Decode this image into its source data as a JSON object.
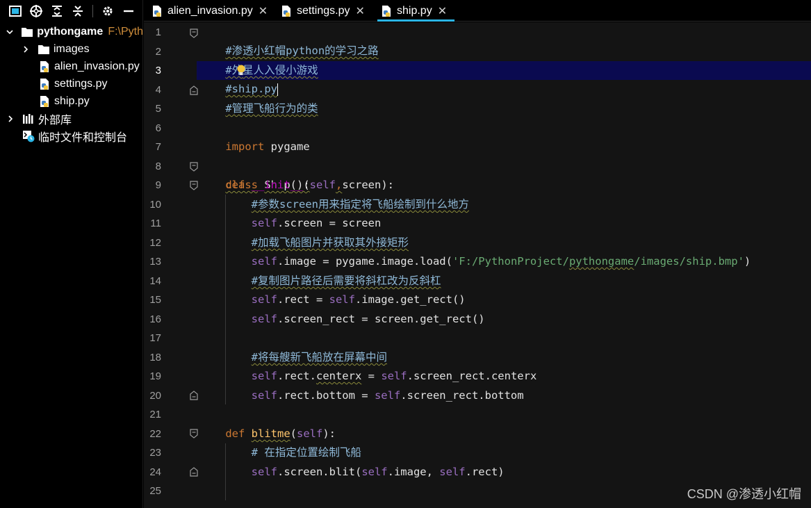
{
  "project_toolbar": {
    "icons": [
      "project-view-icon",
      "locate-icon",
      "expand-all-icon",
      "collapse-all-icon",
      "gear-icon",
      "hide-icon"
    ]
  },
  "project_tree": {
    "root_name": "pythongame",
    "root_path": "F:\\Pyth",
    "items": [
      {
        "label": "images",
        "type": "folder"
      },
      {
        "label": "alien_invasion.py",
        "type": "python-file"
      },
      {
        "label": "settings.py",
        "type": "python-file"
      },
      {
        "label": "ship.py",
        "type": "python-file"
      }
    ],
    "external_libraries": "外部库",
    "scratches": "临时文件和控制台"
  },
  "tabs": [
    {
      "label": "alien_invasion.py",
      "active": false
    },
    {
      "label": "settings.py",
      "active": false
    },
    {
      "label": "ship.py",
      "active": true
    }
  ],
  "editor": {
    "current_line": 3,
    "line_numbers": [
      "1",
      "2",
      "3",
      "4",
      "5",
      "6",
      "7",
      "8",
      "9",
      "10",
      "11",
      "12",
      "13",
      "14",
      "15",
      "16",
      "17",
      "18",
      "19",
      "20",
      "21",
      "22",
      "23",
      "24",
      "25"
    ],
    "code": {
      "l1": "#渗透小红帽python的学习之路",
      "l2a": "#外",
      "l2b": "星人入侵小游戏",
      "l3": "#ship.py",
      "l4": "#管理飞船行为的类",
      "l6_kw": "import",
      "l6_mod": " pygame",
      "l8_kw": "class",
      "l8_name": "Ship",
      "l8_rest": "():",
      "l9_kw": "def",
      "l9_name": "__init__",
      "l9_p1": "(",
      "l9_self": "self",
      "l9_comma": ",",
      "l9_rest": "screen):",
      "l10": "#参数screen用来指定将飞船绘制到什么地方",
      "l11_self": "self",
      "l11_rest": ".screen = screen",
      "l12": "#加载飞船图片并获取其外接矩形",
      "l13_self": "self",
      "l13_mid": ".image = pygame.image.load(",
      "l13_str1": "'F:/PythonProject/",
      "l13_str2": "pythongame",
      "l13_str3": "/images/ship.bmp'",
      "l13_end": ")",
      "l14": "#复制图片路径后需要将斜杠改为反斜杠",
      "l15_self": "self",
      "l15_mid": ".rect = ",
      "l15_self2": "self",
      "l15_end": ".image.get_rect()",
      "l16_self": "self",
      "l16_rest": ".screen_rect = screen.get_rect()",
      "l18": "#将每艘新飞船放在屏幕中间",
      "l19_self": "self",
      "l19_mid": ".rect.",
      "l19_attr": "centerx",
      "l19_eq": " = ",
      "l19_self2": "self",
      "l19_end": ".screen_rect.centerx",
      "l20_self": "self",
      "l20_mid": ".rect.bottom = ",
      "l20_self2": "self",
      "l20_end": ".screen_rect.bottom",
      "l22_kw": "def",
      "l22_name": "blitme",
      "l22_p1": "(",
      "l22_self": "self",
      "l22_end": "):",
      "l23": "# 在指定位置绘制飞船",
      "l24_self": "self",
      "l24_mid": ".screen.blit(",
      "l24_self2": "self",
      "l24_mid2": ".image, ",
      "l24_self3": "self",
      "l24_end": ".rect)"
    }
  },
  "watermark": "CSDN @渗透小红帽",
  "colors": {
    "background": "#141414",
    "comment": "#8fb9d8",
    "keyword": "#cc7832",
    "self": "#9a6ec0",
    "function": "#ffc66d",
    "string": "#6aab73",
    "active_tab_underline": "#2bb5e5",
    "current_line": "#0a0a50"
  }
}
